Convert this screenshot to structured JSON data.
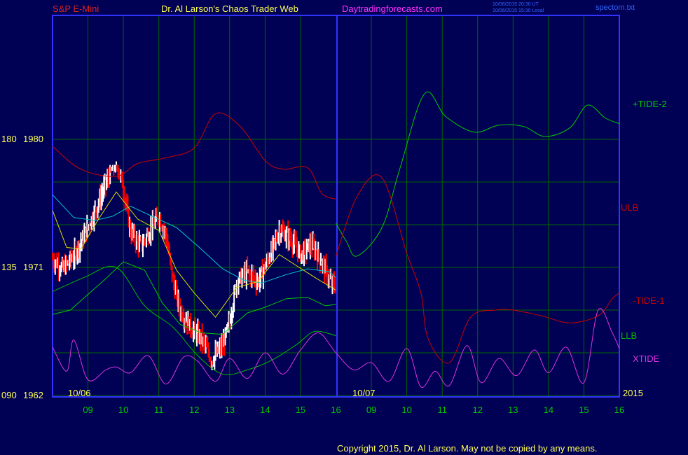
{
  "header": {
    "symbol": "S&P E-Mini",
    "publisher": "Dr. Al Larson's Chaos Trader Web",
    "site": "Daytradingforecasts.com",
    "time_ut": "10/06/2015 20:30 UT",
    "time_local": "10/06/2015 15:30 Local",
    "file": "spectom.txt"
  },
  "footer": {
    "copyright": "Copyright 2015, Dr. Al Larson. May not be copied by any means."
  },
  "colors": {
    "background": "#000055",
    "frame": "#3333ff",
    "grid": "#006600",
    "price_up": "#ffffff",
    "price_down": "#ff0000",
    "tide2": "#00cc00",
    "ulb": "#cc0000",
    "tide1": "#cc0000",
    "llb": "#00bb00",
    "xtide": "#dd33dd",
    "ma_cyan": "#00cccc",
    "ma_yellow": "#dddd00",
    "ma_green": "#00cc00"
  },
  "chart_data": {
    "type": "line",
    "title": "S&P E-Mini",
    "y_axis_labels": [
      {
        "left": "180",
        "right": "1980",
        "value": 1980
      },
      {
        "left": "135",
        "right": "1971",
        "value": 1971
      },
      {
        "left": "090",
        "right": "1962",
        "value": 1962
      }
    ],
    "ylim": [
      1962,
      1980
    ],
    "x_ticks": [
      "09",
      "10",
      "11",
      "12",
      "13",
      "14",
      "15",
      "16",
      "09",
      "10",
      "11",
      "12",
      "13",
      "14",
      "15",
      "16"
    ],
    "date_labels": [
      "10/06",
      "10/07"
    ],
    "year_label": "2015",
    "series": [
      {
        "name": "+TIDE-2",
        "color": "#00cc00",
        "role": "forecast",
        "points": [
          [
            16.0,
            1974.1
          ],
          [
            16.3,
            1972.8
          ],
          [
            16.6,
            1971.8
          ],
          [
            17.3,
            1973.8
          ],
          [
            17.8,
            1977.9
          ],
          [
            18.5,
            1983.2
          ],
          [
            19.1,
            1981.6
          ],
          [
            19.9,
            1980.5
          ],
          [
            20.6,
            1981.0
          ],
          [
            21.3,
            1980.9
          ],
          [
            21.9,
            1980.2
          ],
          [
            22.6,
            1980.8
          ],
          [
            23.1,
            1982.4
          ],
          [
            23.6,
            1981.5
          ],
          [
            24.0,
            1981.1
          ]
        ]
      },
      {
        "name": "ULB",
        "color": "#cc0000",
        "role": "band",
        "points": [
          [
            8.0,
            1979.5
          ],
          [
            8.8,
            1977.9
          ],
          [
            9.8,
            1977.4
          ],
          [
            10.4,
            1978.3
          ],
          [
            11.2,
            1978.7
          ],
          [
            12.0,
            1979.4
          ],
          [
            12.6,
            1981.8
          ],
          [
            13.3,
            1980.9
          ],
          [
            14.0,
            1978.5
          ],
          [
            14.5,
            1977.9
          ],
          [
            15.2,
            1978.0
          ],
          [
            15.6,
            1976.2
          ],
          [
            16.0,
            1975.8
          ]
        ]
      },
      {
        "name": "-TIDE-1",
        "color": "#cc0000",
        "role": "forecast",
        "points": [
          [
            16.0,
            1971.8
          ],
          [
            16.6,
            1976.0
          ],
          [
            17.3,
            1977.3
          ],
          [
            18.0,
            1972.0
          ],
          [
            18.4,
            1969.2
          ],
          [
            18.6,
            1966.0
          ],
          [
            19.2,
            1964.3
          ],
          [
            19.8,
            1967.5
          ],
          [
            20.5,
            1968.0
          ],
          [
            21.0,
            1968.0
          ],
          [
            21.8,
            1967.6
          ],
          [
            22.6,
            1967.1
          ],
          [
            23.4,
            1967.6
          ],
          [
            23.8,
            1968.8
          ],
          [
            24.0,
            1969.2
          ]
        ]
      },
      {
        "name": "LLB",
        "color": "#00bb00",
        "role": "band",
        "points": [
          [
            8.0,
            1969.3
          ],
          [
            8.9,
            1970.3
          ],
          [
            9.8,
            1971.0
          ],
          [
            10.6,
            1968.3
          ],
          [
            11.4,
            1966.8
          ],
          [
            12.1,
            1964.8
          ],
          [
            12.8,
            1963.5
          ],
          [
            13.5,
            1963.8
          ],
          [
            14.2,
            1964.5
          ],
          [
            14.9,
            1965.6
          ],
          [
            15.4,
            1966.5
          ],
          [
            16.0,
            1966.2
          ]
        ]
      },
      {
        "name": "XTIDE",
        "color": "#dd33dd",
        "role": "oscillator",
        "points": [
          [
            8.0,
            1965.4
          ],
          [
            8.4,
            1963.7
          ],
          [
            8.6,
            1965.9
          ],
          [
            9.0,
            1963.1
          ],
          [
            9.5,
            1963.8
          ],
          [
            9.8,
            1964.0
          ],
          [
            10.2,
            1963.6
          ],
          [
            10.7,
            1964.8
          ],
          [
            11.2,
            1962.8
          ],
          [
            11.7,
            1964.7
          ],
          [
            12.1,
            1964.4
          ],
          [
            12.6,
            1963.0
          ],
          [
            13.0,
            1964.6
          ],
          [
            13.5,
            1963.2
          ],
          [
            14.0,
            1965.0
          ],
          [
            14.5,
            1963.5
          ],
          [
            15.0,
            1965.2
          ],
          [
            15.5,
            1966.4
          ],
          [
            16.0,
            1965.0
          ],
          [
            16.5,
            1963.8
          ],
          [
            17.0,
            1964.3
          ],
          [
            17.5,
            1963.0
          ],
          [
            18.0,
            1965.3
          ],
          [
            18.4,
            1962.6
          ],
          [
            18.8,
            1963.7
          ],
          [
            19.2,
            1962.7
          ],
          [
            19.7,
            1965.5
          ],
          [
            20.1,
            1962.9
          ],
          [
            20.6,
            1964.6
          ],
          [
            21.1,
            1963.4
          ],
          [
            21.6,
            1965.2
          ],
          [
            22.0,
            1963.6
          ],
          [
            22.5,
            1965.4
          ],
          [
            23.0,
            1962.9
          ],
          [
            23.4,
            1968.0
          ],
          [
            23.8,
            1966.4
          ],
          [
            24.0,
            1965.3
          ]
        ]
      }
    ],
    "moving_averages": [
      {
        "color": "#00cccc",
        "points": [
          [
            8.0,
            1976.1
          ],
          [
            8.6,
            1974.5
          ],
          [
            9.2,
            1974.3
          ],
          [
            9.7,
            1974.6
          ],
          [
            10.2,
            1975.3
          ],
          [
            10.8,
            1974.6
          ],
          [
            11.5,
            1973.8
          ],
          [
            12.1,
            1972.5
          ],
          [
            12.8,
            1970.9
          ],
          [
            13.4,
            1970.1
          ],
          [
            13.9,
            1969.9
          ],
          [
            14.6,
            1970.5
          ],
          [
            15.2,
            1970.9
          ],
          [
            15.8,
            1970.7
          ],
          [
            16.0,
            1970.3
          ]
        ]
      },
      {
        "color": "#dddd00",
        "points": [
          [
            8.0,
            1975.0
          ],
          [
            8.4,
            1972.4
          ],
          [
            8.8,
            1972.3
          ],
          [
            9.3,
            1974.4
          ],
          [
            9.8,
            1976.3
          ],
          [
            10.4,
            1974.4
          ],
          [
            11.0,
            1973.6
          ],
          [
            11.5,
            1970.8
          ],
          [
            12.0,
            1969.2
          ],
          [
            12.6,
            1967.5
          ],
          [
            13.2,
            1969.6
          ],
          [
            13.8,
            1970.0
          ],
          [
            14.4,
            1971.9
          ],
          [
            14.9,
            1971.1
          ],
          [
            15.4,
            1970.3
          ],
          [
            16.0,
            1969.4
          ]
        ]
      },
      {
        "color": "#00cc00",
        "points": [
          [
            8.0,
            1967.7
          ],
          [
            8.5,
            1968.0
          ],
          [
            9.0,
            1969.1
          ],
          [
            9.5,
            1970.2
          ],
          [
            10.0,
            1971.4
          ],
          [
            10.6,
            1970.8
          ],
          [
            11.1,
            1968.5
          ],
          [
            11.6,
            1967.0
          ],
          [
            12.2,
            1966.4
          ],
          [
            12.8,
            1966.3
          ],
          [
            13.5,
            1967.8
          ],
          [
            14.0,
            1968.2
          ],
          [
            14.6,
            1968.8
          ],
          [
            15.2,
            1968.9
          ],
          [
            15.7,
            1968.3
          ],
          [
            16.0,
            1968.4
          ]
        ]
      }
    ],
    "price_bars": {
      "description": "S&P E-Mini one-day intraday price bars",
      "close_path": [
        [
          8.0,
          1971.6
        ],
        [
          8.3,
          1970.9
        ],
        [
          8.6,
          1971.8
        ],
        [
          8.9,
          1973.3
        ],
        [
          9.2,
          1975.0
        ],
        [
          9.5,
          1976.8
        ],
        [
          9.8,
          1978.5
        ],
        [
          10.0,
          1976.6
        ],
        [
          10.2,
          1973.5
        ],
        [
          10.5,
          1972.5
        ],
        [
          10.8,
          1973.8
        ],
        [
          11.0,
          1974.6
        ],
        [
          11.2,
          1973.3
        ],
        [
          11.4,
          1970.1
        ],
        [
          11.6,
          1968.0
        ],
        [
          11.9,
          1966.8
        ],
        [
          12.2,
          1966.0
        ],
        [
          12.5,
          1964.5
        ],
        [
          12.8,
          1965.5
        ],
        [
          13.0,
          1967.2
        ],
        [
          13.2,
          1970.0
        ],
        [
          13.5,
          1970.7
        ],
        [
          13.8,
          1970.0
        ],
        [
          14.1,
          1971.6
        ],
        [
          14.4,
          1973.6
        ],
        [
          14.7,
          1973.1
        ],
        [
          15.0,
          1971.9
        ],
        [
          15.3,
          1972.6
        ],
        [
          15.6,
          1971.4
        ],
        [
          15.8,
          1970.2
        ],
        [
          16.0,
          1969.6
        ]
      ],
      "high": 1978.2,
      "low": 1962.2
    }
  }
}
